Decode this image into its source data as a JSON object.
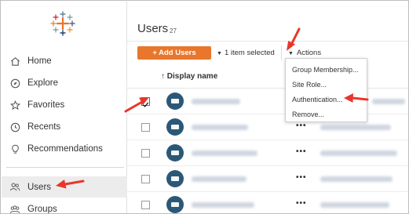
{
  "sidebar": {
    "items": [
      {
        "label": "Home",
        "icon": "home-icon"
      },
      {
        "label": "Explore",
        "icon": "compass-icon"
      },
      {
        "label": "Favorites",
        "icon": "star-icon"
      },
      {
        "label": "Recents",
        "icon": "clock-icon"
      },
      {
        "label": "Recommendations",
        "icon": "lightbulb-icon"
      }
    ],
    "users_label": "Users",
    "groups_label": "Groups"
  },
  "header": {
    "title": "Users",
    "count": "27"
  },
  "toolbar": {
    "add_label": "+ Add Users",
    "selection": "1 item selected",
    "actions_label": "Actions"
  },
  "table": {
    "column_header": "Display name",
    "sort_indicator": "↑",
    "row_action": "•••"
  },
  "actions_menu": [
    "Group Membership...",
    "Site Role...",
    "Authentication...",
    "Remove..."
  ],
  "colors": {
    "accent": "#e8762c",
    "arrow": "#e8372a",
    "avatar": "#2c5878"
  }
}
